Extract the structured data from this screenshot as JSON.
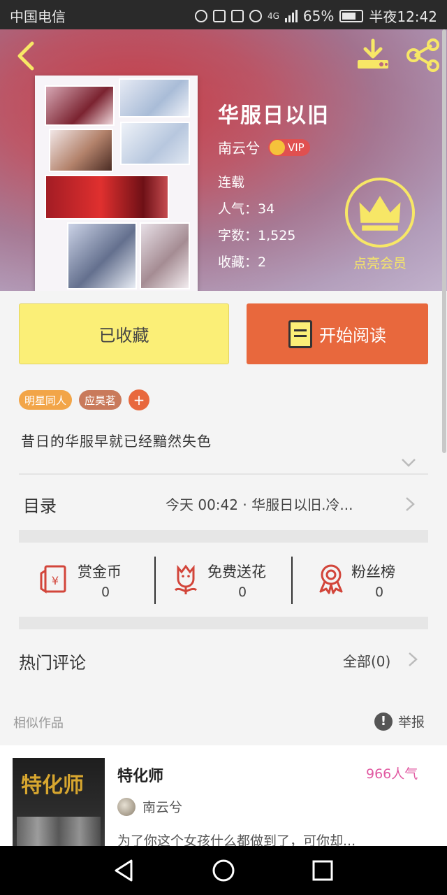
{
  "status_bar": {
    "carrier": "中国电信",
    "network": "4G",
    "battery": "65%",
    "time": "半夜12:42"
  },
  "book": {
    "title": "华服日以旧",
    "author": "南云兮",
    "vip": "VIP",
    "status": "连载",
    "popularity": "人气：34",
    "word_count": "字数：1,525",
    "favorites": "收藏：2",
    "member_label": "点亮会员",
    "intro": "昔日的华服早就已经黯然失色"
  },
  "actions": {
    "collected_label": "已收藏",
    "read_label": "开始阅读"
  },
  "tags": [
    "明星同人",
    "应昊茗"
  ],
  "tag_add": "+",
  "catalog": {
    "title": "目录",
    "latest": "今天 00:42 · 华服日以旧.冷..."
  },
  "rewards": [
    {
      "label": "赏金币",
      "count": "0",
      "icon": "coin-envelope-icon"
    },
    {
      "label": "免费送花",
      "count": "0",
      "icon": "flower-icon"
    },
    {
      "label": "粉丝榜",
      "count": "0",
      "icon": "ribbon-medal-icon"
    }
  ],
  "comments": {
    "title": "热门评论",
    "all": "全部(0)"
  },
  "similar": {
    "label": "相似作品",
    "report": "举报",
    "items": [
      {
        "title": "特化师",
        "popularity": "966人气",
        "author": "南云兮",
        "description": "为了你这个女孩什么都做到了，可你却...",
        "cover_text": "特化师"
      }
    ]
  },
  "colors": {
    "accent_yellow": "#fbef77",
    "accent_orange": "#e8683d",
    "member_yellow": "#f7e766",
    "popularity_pink": "#e15aa2"
  }
}
